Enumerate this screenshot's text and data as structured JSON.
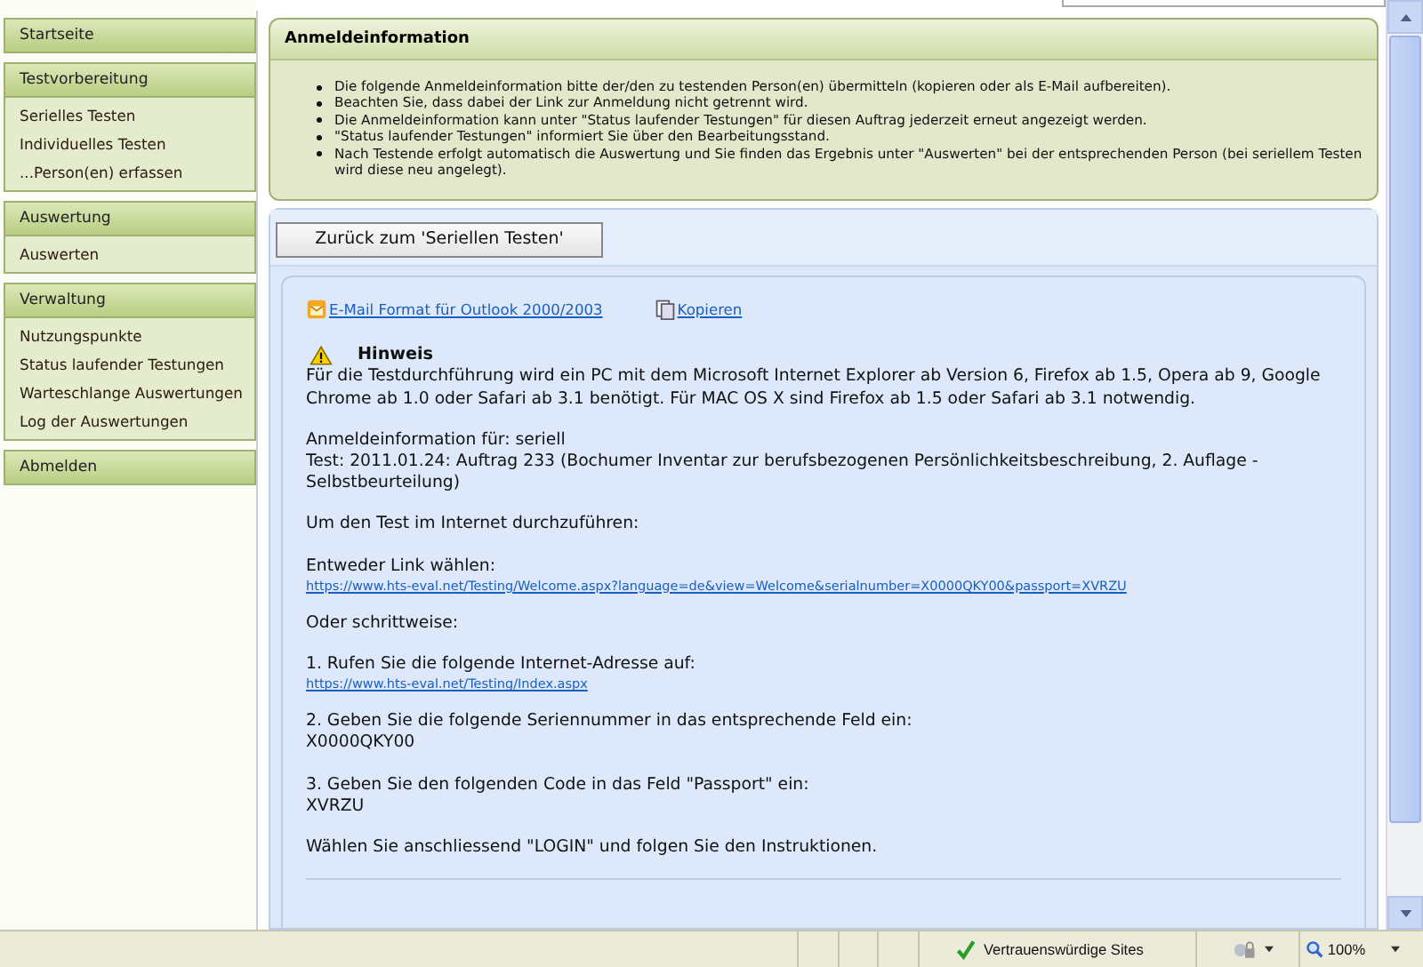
{
  "sidebar": {
    "groups": [
      {
        "title": "Startseite"
      },
      {
        "title": "Testvorbereitung",
        "items": [
          {
            "label": "Serielles Testen"
          },
          {
            "label": "Individuelles Testen"
          },
          {
            "label": "...Person(en) erfassen"
          }
        ]
      },
      {
        "title": "Auswertung",
        "items": [
          {
            "label": "Auswerten"
          }
        ]
      },
      {
        "title": "Verwaltung",
        "items": [
          {
            "label": "Nutzungspunkte"
          },
          {
            "label": "Status laufender Testungen"
          },
          {
            "label": "Warteschlange Auswertungen"
          },
          {
            "label": "Log der Auswertungen"
          }
        ]
      },
      {
        "title": "Abmelden"
      }
    ]
  },
  "notice": {
    "title": "Anmeldeinformation",
    "bullets": [
      "Die folgende Anmeldeinformation bitte der/den zu testenden Person(en) übermitteln (kopieren oder als E-Mail aufbereiten).",
      "Beachten Sie, dass dabei der Link zur Anmeldung nicht getrennt wird.",
      "Die Anmeldeinformation kann unter \"Status laufender Testungen\" für diesen Auftrag jederzeit erneut angezeigt werden.",
      "\"Status laufender Testungen\" informiert Sie über den Bearbeitungsstand.",
      "Nach Testende erfolgt automatisch die Auswertung und Sie finden das Ergebnis unter \"Auswerten\" bei der entsprechenden Person (bei seriellem Testen wird diese neu angelegt)."
    ]
  },
  "back_button": "Zurück zum 'Seriellen Testen'",
  "message": {
    "actions": [
      {
        "kind": "email",
        "label": "E-Mail Format für Outlook 2000/2003"
      },
      {
        "kind": "copy",
        "label": "Kopieren"
      }
    ],
    "hint_title": "Hinweis",
    "paragraphs": [
      {
        "lines": [
          {
            "kind": "text",
            "text": "Für die Testdurchführung wird ein PC mit dem Microsoft Internet Explorer ab Version 6, Firefox ab 1.5, Opera ab 9, Google Chrome ab 1.0 oder Safari ab 3.1 benötigt. Für MAC OS X sind Firefox ab 1.5 oder Safari ab 3.1 notwendig."
          }
        ]
      },
      {
        "lines": [
          {
            "kind": "text",
            "text": "Anmeldeinformation für: seriell"
          },
          {
            "kind": "text",
            "text": "Test: 2011.01.24: Auftrag 233 (Bochumer Inventar zur berufsbezogenen Persönlichkeitsbeschreibung, 2. Auflage - Selbstbeurteilung)"
          }
        ]
      },
      {
        "lines": [
          {
            "kind": "text",
            "text": "Um den Test im Internet durchzuführen:"
          }
        ]
      },
      {
        "lines": [
          {
            "kind": "text",
            "text": "Entweder Link wählen:"
          },
          {
            "kind": "link",
            "text": "https://www.hts-eval.net/Testing/Welcome.aspx?language=de&view=Welcome&serialnumber=X0000QKY00&passport=XVRZU"
          }
        ]
      },
      {
        "lines": [
          {
            "kind": "text",
            "text": "Oder schrittweise:"
          }
        ]
      },
      {
        "lines": [
          {
            "kind": "text",
            "text": "1. Rufen Sie die folgende Internet-Adresse auf:"
          },
          {
            "kind": "link",
            "text": "https://www.hts-eval.net/Testing/Index.aspx"
          }
        ]
      },
      {
        "lines": [
          {
            "kind": "text",
            "text": "2. Geben Sie die folgende Seriennummer in das entsprechende Feld ein:"
          },
          {
            "kind": "text",
            "text": "X0000QKY00"
          }
        ]
      },
      {
        "lines": [
          {
            "kind": "text",
            "text": "3. Geben Sie den folgenden Code in das Feld \"Passport\" ein:"
          },
          {
            "kind": "text",
            "text": "XVRZU"
          }
        ]
      },
      {
        "lines": [
          {
            "kind": "text",
            "text": "Wählen Sie anschliessend \"LOGIN\" und folgen Sie den Instruktionen."
          }
        ]
      }
    ]
  },
  "status_bar": {
    "zone": "Vertrauenswürdige Sites",
    "zoom": "100%"
  }
}
